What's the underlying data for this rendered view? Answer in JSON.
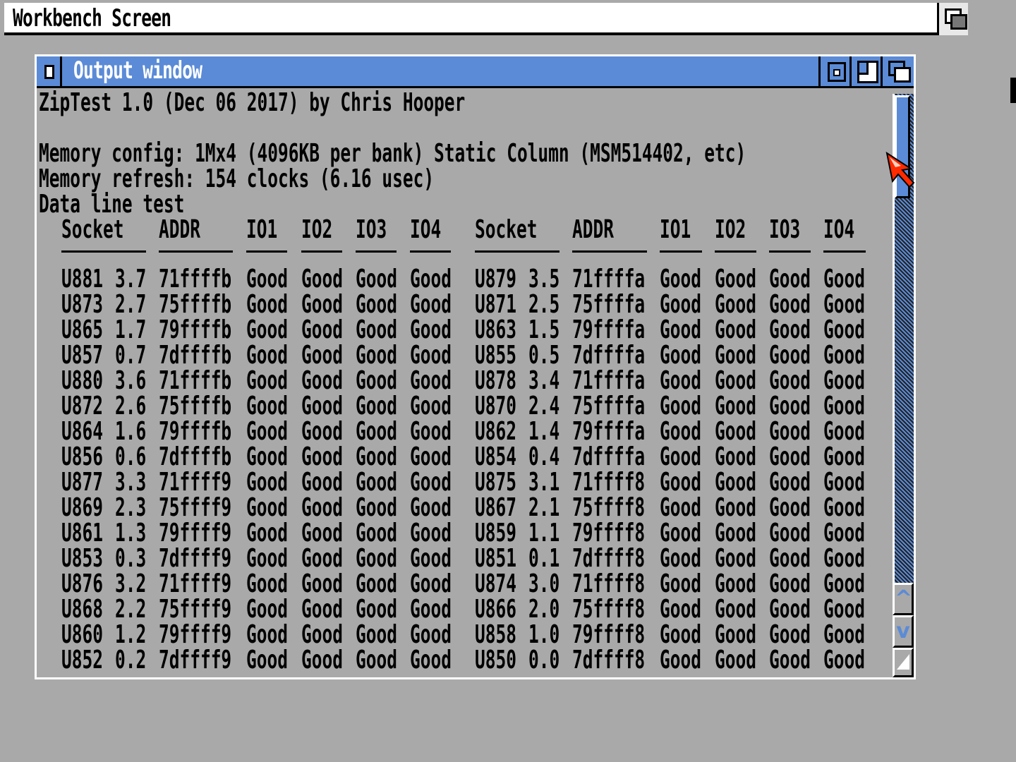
{
  "screen": {
    "title": "Workbench Screen"
  },
  "window": {
    "title": "Output window"
  },
  "lines": {
    "header": "ZipTest 1.0 (Dec 06 2017) by Chris Hooper",
    "blank": "",
    "mem_config": "Memory config: 1Mx4 (4096KB per bank) Static Column (MSM514402, etc)",
    "mem_refresh": "Memory refresh: 154 clocks (6.16 usec)",
    "test_name": "Data line test"
  },
  "table": {
    "columns": [
      "Socket",
      "ADDR",
      "IO1",
      "IO2",
      "IO3",
      "IO4"
    ],
    "rows": [
      [
        "U881",
        "3.7",
        "71ffffb",
        "Good",
        "Good",
        "Good",
        "Good",
        "U879",
        "3.5",
        "71ffffa",
        "Good",
        "Good",
        "Good",
        "Good"
      ],
      [
        "U873",
        "2.7",
        "75ffffb",
        "Good",
        "Good",
        "Good",
        "Good",
        "U871",
        "2.5",
        "75ffffa",
        "Good",
        "Good",
        "Good",
        "Good"
      ],
      [
        "U865",
        "1.7",
        "79ffffb",
        "Good",
        "Good",
        "Good",
        "Good",
        "U863",
        "1.5",
        "79ffffa",
        "Good",
        "Good",
        "Good",
        "Good"
      ],
      [
        "U857",
        "0.7",
        "7dffffb",
        "Good",
        "Good",
        "Good",
        "Good",
        "U855",
        "0.5",
        "7dffffa",
        "Good",
        "Good",
        "Good",
        "Good"
      ],
      [
        "U880",
        "3.6",
        "71ffffb",
        "Good",
        "Good",
        "Good",
        "Good",
        "U878",
        "3.4",
        "71ffffa",
        "Good",
        "Good",
        "Good",
        "Good"
      ],
      [
        "U872",
        "2.6",
        "75ffffb",
        "Good",
        "Good",
        "Good",
        "Good",
        "U870",
        "2.4",
        "75ffffa",
        "Good",
        "Good",
        "Good",
        "Good"
      ],
      [
        "U864",
        "1.6",
        "79ffffb",
        "Good",
        "Good",
        "Good",
        "Good",
        "U862",
        "1.4",
        "79ffffa",
        "Good",
        "Good",
        "Good",
        "Good"
      ],
      [
        "U856",
        "0.6",
        "7dffffb",
        "Good",
        "Good",
        "Good",
        "Good",
        "U854",
        "0.4",
        "7dffffa",
        "Good",
        "Good",
        "Good",
        "Good"
      ],
      [
        "U877",
        "3.3",
        "71ffff9",
        "Good",
        "Good",
        "Good",
        "Good",
        "U875",
        "3.1",
        "71ffff8",
        "Good",
        "Good",
        "Good",
        "Good"
      ],
      [
        "U869",
        "2.3",
        "75ffff9",
        "Good",
        "Good",
        "Good",
        "Good",
        "U867",
        "2.1",
        "75ffff8",
        "Good",
        "Good",
        "Good",
        "Good"
      ],
      [
        "U861",
        "1.3",
        "79ffff9",
        "Good",
        "Good",
        "Good",
        "Good",
        "U859",
        "1.1",
        "79ffff8",
        "Good",
        "Good",
        "Good",
        "Good"
      ],
      [
        "U853",
        "0.3",
        "7dffff9",
        "Good",
        "Good",
        "Good",
        "Good",
        "U851",
        "0.1",
        "7dffff8",
        "Good",
        "Good",
        "Good",
        "Good"
      ],
      [
        "U876",
        "3.2",
        "71ffff9",
        "Good",
        "Good",
        "Good",
        "Good",
        "U874",
        "3.0",
        "71ffff8",
        "Good",
        "Good",
        "Good",
        "Good"
      ],
      [
        "U868",
        "2.2",
        "75ffff9",
        "Good",
        "Good",
        "Good",
        "Good",
        "U866",
        "2.0",
        "75ffff8",
        "Good",
        "Good",
        "Good",
        "Good"
      ],
      [
        "U860",
        "1.2",
        "79ffff9",
        "Good",
        "Good",
        "Good",
        "Good",
        "U858",
        "1.0",
        "79ffff8",
        "Good",
        "Good",
        "Good",
        "Good"
      ],
      [
        "U852",
        "0.2",
        "7dffff9",
        "Good",
        "Good",
        "Good",
        "Good",
        "U850",
        "0.0",
        "7dffff8",
        "Good",
        "Good",
        "Good",
        "Good"
      ]
    ]
  },
  "icons": {
    "close": "close-icon",
    "zoom": "zoom-icon",
    "size": "resize-icon",
    "depth": "depth-icon",
    "up": "arrow-up-icon",
    "down": "arrow-down-icon"
  },
  "colors": {
    "accent": "#5b8bd6",
    "background": "#a9a9a9",
    "pointer": "#ff2a00"
  }
}
